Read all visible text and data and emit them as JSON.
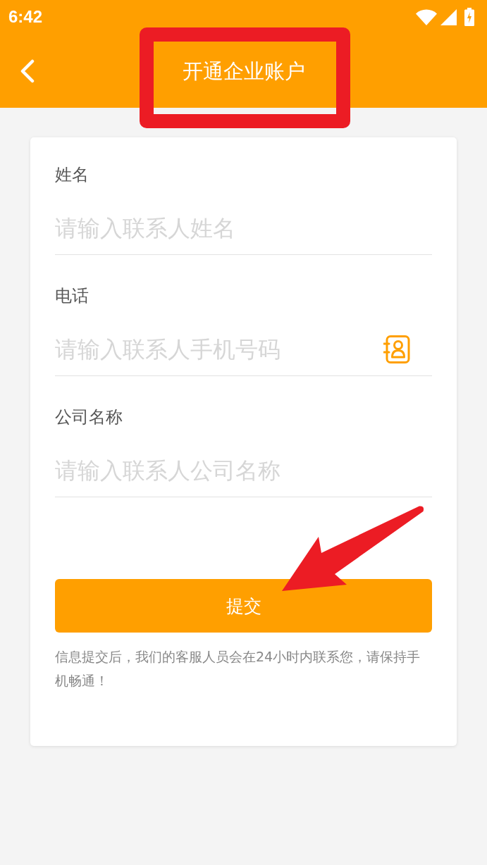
{
  "status_bar": {
    "time": "6:42"
  },
  "header": {
    "title": "开通企业账户"
  },
  "form": {
    "fields": [
      {
        "label": "姓名",
        "placeholder": "请输入联系人姓名",
        "kind": "text"
      },
      {
        "label": "电话",
        "placeholder": "请输入联系人手机号码",
        "kind": "contact-picker"
      },
      {
        "label": "公司名称",
        "placeholder": "请输入联系人公司名称",
        "kind": "text"
      }
    ],
    "submit_button": "提交",
    "note": "信息提交后，我们的客服人员会在24小时内联系您，请保持手机畅通！"
  }
}
